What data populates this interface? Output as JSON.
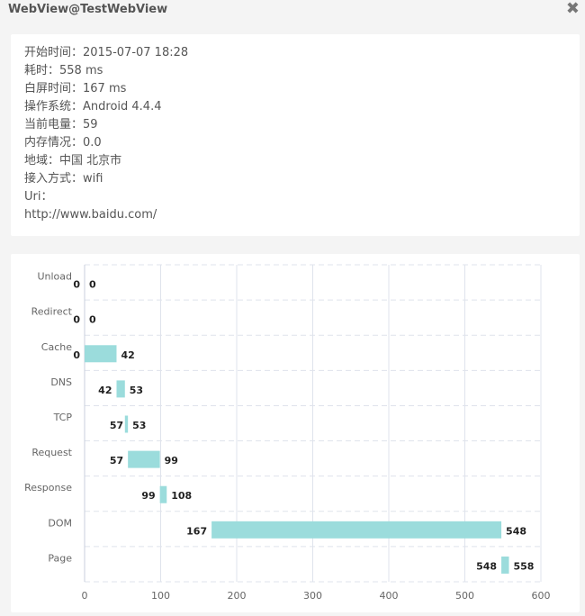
{
  "window": {
    "title": "WebView@TestWebView",
    "close_icon": "close-icon"
  },
  "info": {
    "lines": [
      "开始时间：2015-07-07 18:28",
      "耗时：558 ms",
      "白屏时间：167 ms",
      "操作系统：Android 4.4.4",
      "当前电量：59",
      "内存情况：0.0",
      "地域：中国 北京市",
      "接入方式：wifi",
      "Uri：",
      "http://www.baidu.com/"
    ]
  },
  "colors": {
    "bar": "#9bdcdc",
    "grid": "#dfe3ec",
    "panel": "#ffffff",
    "background": "#f4f4f4"
  },
  "chart_data": {
    "type": "bar",
    "orientation": "horizontal-range",
    "categories": [
      "Unload",
      "Redirect",
      "Cache",
      "DNS",
      "TCP",
      "Request",
      "Response",
      "DOM",
      "Page"
    ],
    "ranges": [
      [
        0,
        0
      ],
      [
        0,
        0
      ],
      [
        0,
        42
      ],
      [
        42,
        53
      ],
      [
        57,
        53
      ],
      [
        57,
        99
      ],
      [
        99,
        108
      ],
      [
        167,
        548
      ],
      [
        548,
        558
      ]
    ],
    "xlim": [
      0,
      600
    ],
    "xticks": [
      0,
      100,
      200,
      300,
      400,
      500,
      600
    ],
    "grid": true,
    "legend": "none"
  }
}
